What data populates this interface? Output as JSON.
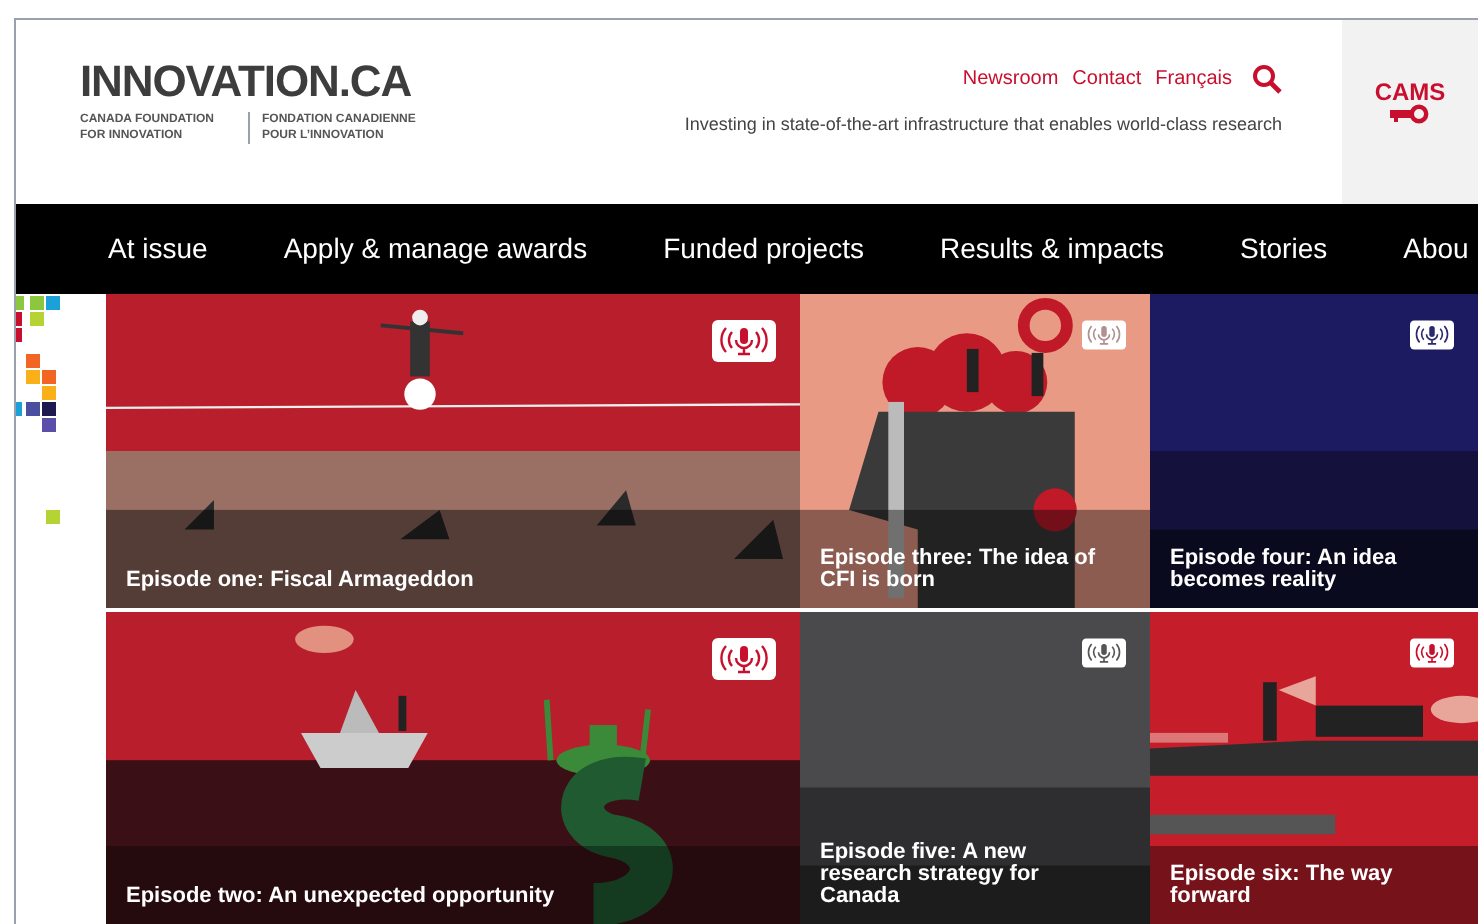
{
  "header": {
    "logo": "INNOVATION.CA",
    "logo_en": "CANADA FOUNDATION FOR INNOVATION",
    "logo_fr": "FONDATION CANADIENNE POUR L’INNOVATION",
    "links": [
      "Newsroom",
      "Contact",
      "Français"
    ],
    "tagline": "Investing in state-of-the-art infrastructure that enables world-class research",
    "cams": "CAMS"
  },
  "nav": [
    "At issue",
    "Apply & manage awards",
    "Funded projects",
    "Results & impacts",
    "Stories",
    "Abou"
  ],
  "tiles": [
    {
      "title": "Episode one: Fiscal Armageddon",
      "kind": "picture"
    },
    {
      "title": "Episode three: The idea of CFI is born",
      "kind": "picture"
    },
    {
      "title": "Episode four: An idea becomes reality",
      "kind": "picture"
    },
    {
      "title": "Episode two: An unexpected opportunity",
      "kind": "picture"
    },
    {
      "title": "Episode five: A new research strategy for Canada",
      "kind": "picture"
    },
    {
      "title": "Episode six: The way forward",
      "kind": "picture"
    }
  ]
}
